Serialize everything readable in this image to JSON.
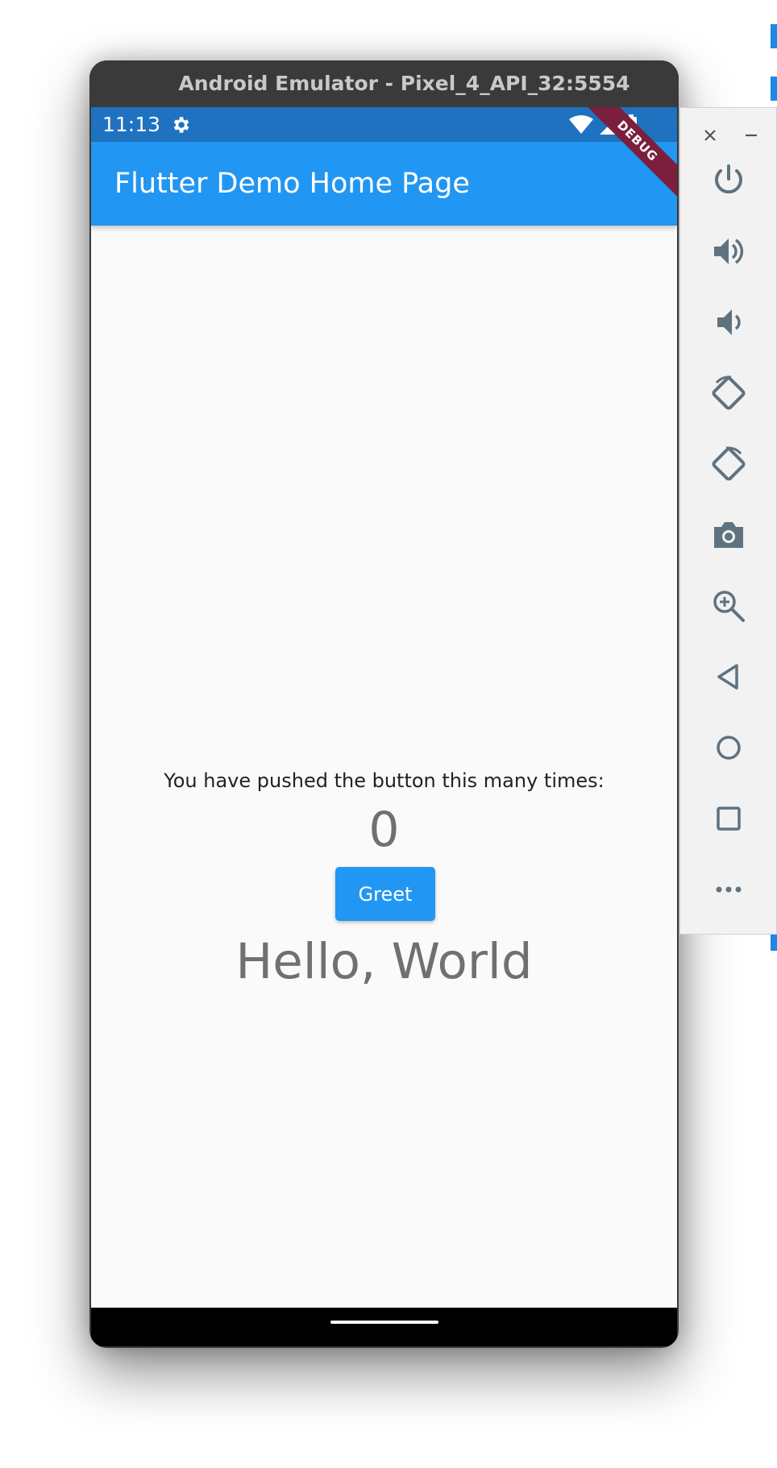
{
  "emulator": {
    "title": "Android Emulator - Pixel_4_API_32:5554"
  },
  "status_bar": {
    "time": "11:13"
  },
  "app": {
    "title": "Flutter Demo Home Page",
    "debug_banner": "DEBUG",
    "counter_label": "You have pushed the button this many times:",
    "counter_value": "0",
    "greet_label": "Greet",
    "greeting": "Hello, World"
  },
  "toolbar": {
    "items": [
      "power-icon",
      "volume-up-icon",
      "volume-down-icon",
      "rotate-left-icon",
      "rotate-right-icon",
      "camera-icon",
      "zoom-in-icon",
      "back-icon",
      "home-icon",
      "overview-icon",
      "more-icon"
    ]
  },
  "colors": {
    "app_bar": "#2196f3",
    "status_bar": "#1e72c0",
    "debug_banner": "#7b1f3d",
    "toolbar_icon": "#5f7280"
  }
}
